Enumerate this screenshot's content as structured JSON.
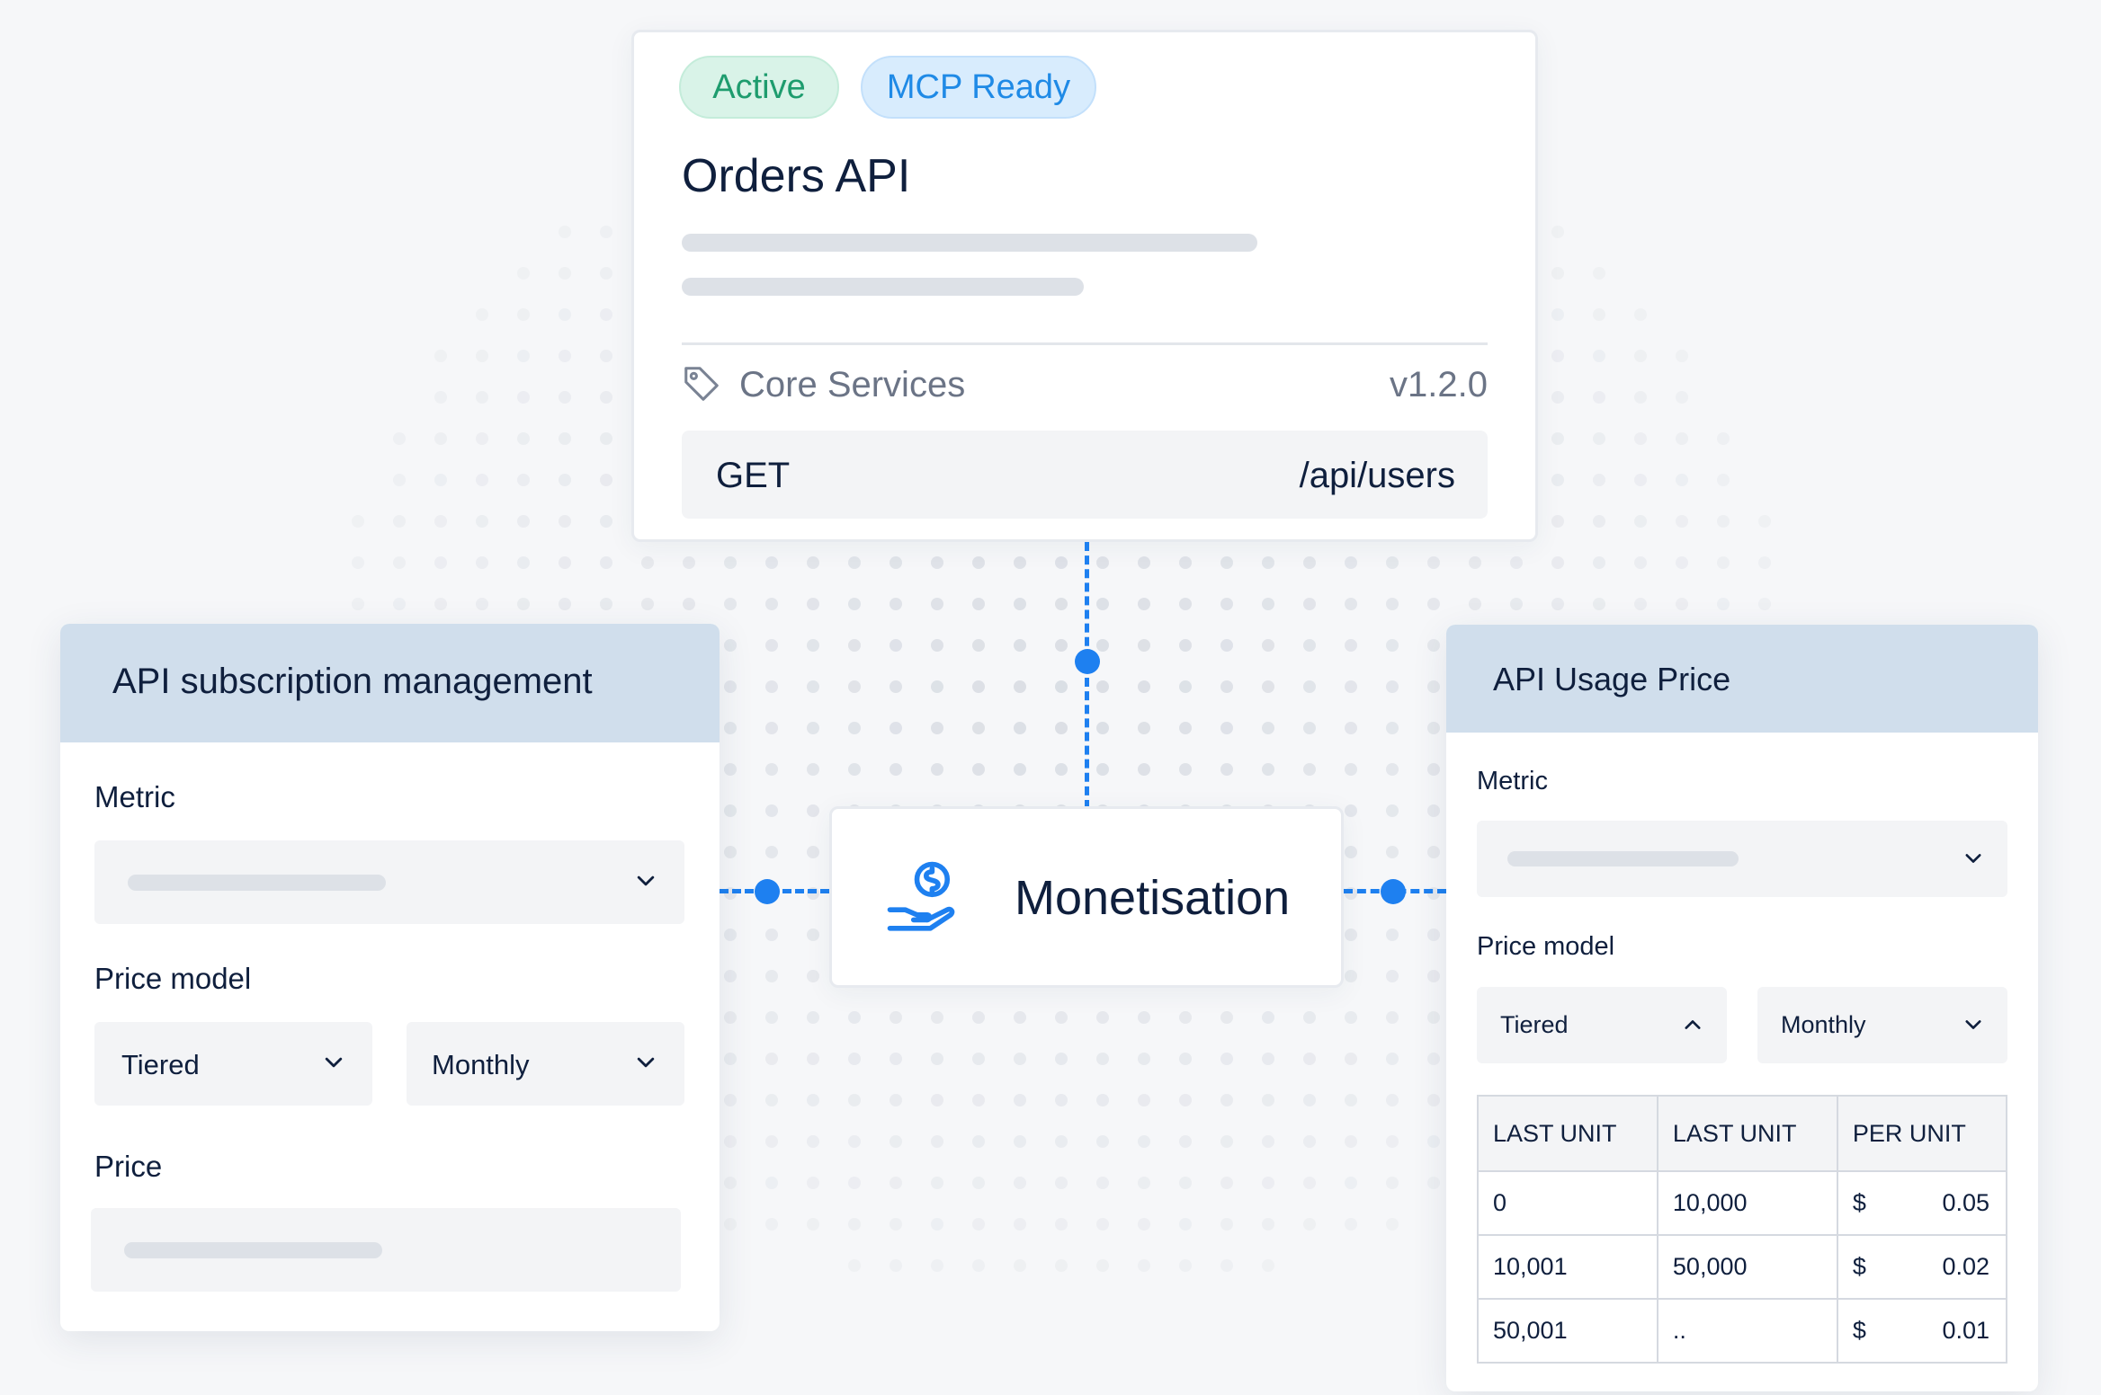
{
  "api_card": {
    "badges": {
      "active": "Active",
      "mcp": "MCP Ready"
    },
    "title": "Orders API",
    "category": "Core Services",
    "version": "v1.2.0",
    "endpoint": {
      "method": "GET",
      "path": "/api/users"
    },
    "icons": {
      "tag": "tag-icon"
    }
  },
  "monetisation": {
    "label": "Monetisation",
    "icon": "hand-coin-icon"
  },
  "subscription_panel": {
    "title": "API subscription management",
    "metric_label": "Metric",
    "price_model_label": "Price model",
    "price_model_value": "Tiered",
    "period_value": "Monthly",
    "price_label": "Price"
  },
  "usage_panel": {
    "title": "API Usage Price",
    "metric_label": "Metric",
    "price_model_label": "Price model",
    "price_model_value": "Tiered",
    "period_value": "Monthly",
    "table": {
      "headers": [
        "LAST UNIT",
        "LAST UNIT",
        "PER UNIT"
      ],
      "rows": [
        {
          "from": "0",
          "to": "10,000",
          "currency": "$",
          "price": "0.05"
        },
        {
          "from": "10,001",
          "to": "50,000",
          "currency": "$",
          "price": "0.02"
        },
        {
          "from": "50,001",
          "to": "..",
          "currency": "$",
          "price": "0.01"
        }
      ]
    }
  },
  "colors": {
    "accent": "#1e80f0",
    "header_bg": "#d0deec",
    "active_badge_bg": "#d9f3e8",
    "active_badge_text": "#1e9c6e",
    "mcp_badge_bg": "#d8ecfd",
    "mcp_badge_text": "#1f8ae6",
    "text_primary": "#0f1f3d"
  }
}
